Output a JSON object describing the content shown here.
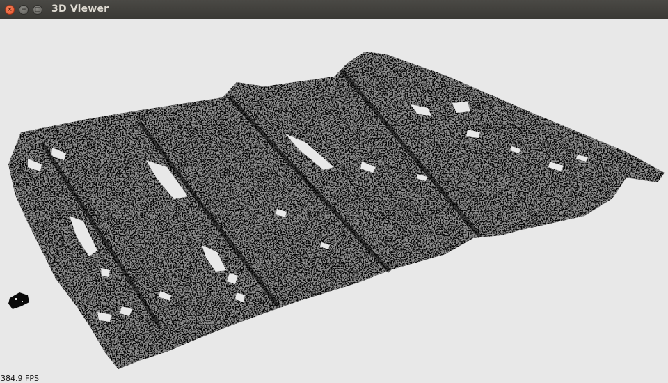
{
  "window": {
    "title": "3D Viewer",
    "controls": {
      "close_glyph": "×",
      "minimize_glyph": "−",
      "maximize_glyph": "□"
    }
  },
  "viewer": {
    "fps_text": "384.9 FPS",
    "background_color": "#e8e8e8",
    "point_color": "#000000"
  }
}
